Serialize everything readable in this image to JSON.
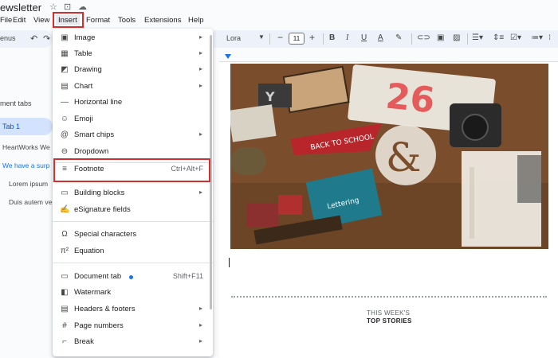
{
  "app": {
    "doc_title": "ewsletter",
    "title_icons": [
      "star-icon",
      "move-to-folder-icon",
      "cloud-status-icon"
    ]
  },
  "menubar": {
    "items": [
      "File",
      "Edit",
      "View",
      "Insert",
      "Format",
      "Tools",
      "Extensions",
      "Help"
    ],
    "active": "Insert"
  },
  "toolbar": {
    "search_label": "enus",
    "font": "Lora",
    "font_size": "11"
  },
  "sidebar": {
    "heading": "ment tabs",
    "tab_label": "Tab 1",
    "items": [
      {
        "text": "HeartWorks We",
        "color": "#444746"
      },
      {
        "text": "We have a surp",
        "color": "#1a73e8"
      },
      {
        "text": "Lorem ipsum",
        "color": "#444746"
      },
      {
        "text": "Duis autem ve",
        "color": "#444746"
      }
    ]
  },
  "page": {
    "this_weeks": "THIS WEEK'S",
    "top_stories": "TOP STORIES"
  },
  "insert_menu": {
    "items": [
      {
        "icon": "image-icon",
        "label": "Image",
        "submenu": true
      },
      {
        "icon": "table-icon",
        "label": "Table",
        "submenu": true
      },
      {
        "icon": "drawing-icon",
        "label": "Drawing",
        "submenu": true
      },
      {
        "icon": "chart-icon",
        "label": "Chart",
        "submenu": true
      },
      {
        "icon": "horizontal-line-icon",
        "label": "Horizontal line"
      },
      {
        "icon": "emoji-icon",
        "label": "Emoji"
      },
      {
        "icon": "smart-chips-icon",
        "label": "Smart chips",
        "submenu": true
      },
      {
        "icon": "dropdown-icon",
        "label": "Dropdown"
      },
      {
        "icon": "footnote-icon",
        "label": "Footnote",
        "shortcut": "Ctrl+Alt+F"
      },
      {
        "icon": "building-blocks-icon",
        "label": "Building blocks",
        "submenu": true
      },
      {
        "icon": "esignature-icon",
        "label": "eSignature fields"
      },
      {
        "icon": "special-characters-icon",
        "label": "Special characters"
      },
      {
        "icon": "equation-icon",
        "label": "Equation"
      },
      {
        "icon": "document-tab-icon",
        "label": "Document tab",
        "shortcut": "Shift+F11"
      },
      {
        "icon": "watermark-icon",
        "label": "Watermark"
      },
      {
        "icon": "headers-footers-icon",
        "label": "Headers & footers",
        "submenu": true
      },
      {
        "icon": "page-numbers-icon",
        "label": "Page numbers",
        "submenu": true
      },
      {
        "icon": "break-icon",
        "label": "Break",
        "submenu": true
      }
    ]
  },
  "colors": {
    "highlight": "#d32f2f",
    "accent": "#1a73e8"
  }
}
